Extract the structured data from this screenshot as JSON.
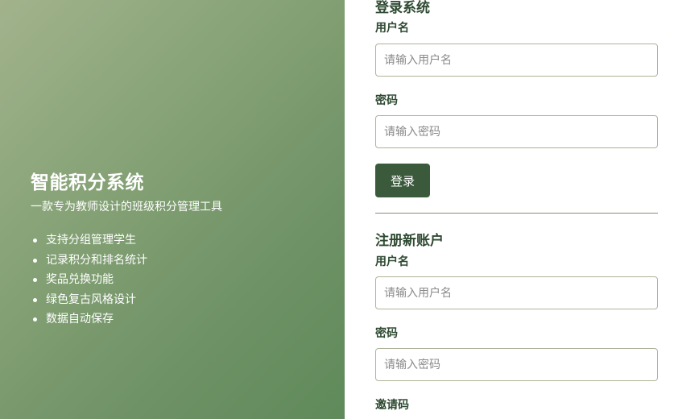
{
  "hero": {
    "title": "智能积分系统",
    "subtitle": "一款专为教师设计的班级积分管理工具",
    "features": [
      "支持分组管理学生",
      "记录积分和排名统计",
      "奖品兑换功能",
      "绿色复古风格设计",
      "数据自动保存"
    ]
  },
  "login": {
    "title": "登录系统",
    "username_label": "用户名",
    "username_placeholder": "请输入用户名",
    "password_label": "密码",
    "password_placeholder": "请输入密码",
    "submit_label": "登录"
  },
  "register": {
    "title": "注册新账户",
    "username_label": "用户名",
    "username_placeholder": "请输入用户名",
    "password_label": "密码",
    "password_placeholder": "请输入密码",
    "invite_label": "邀请码"
  },
  "colors": {
    "hero_gradient_start": "#a2b38c",
    "hero_gradient_end": "#5f8a5a",
    "primary_button": "#3b5a3c",
    "heading_text": "#2f4a32",
    "input_border": "#b0b29a"
  }
}
